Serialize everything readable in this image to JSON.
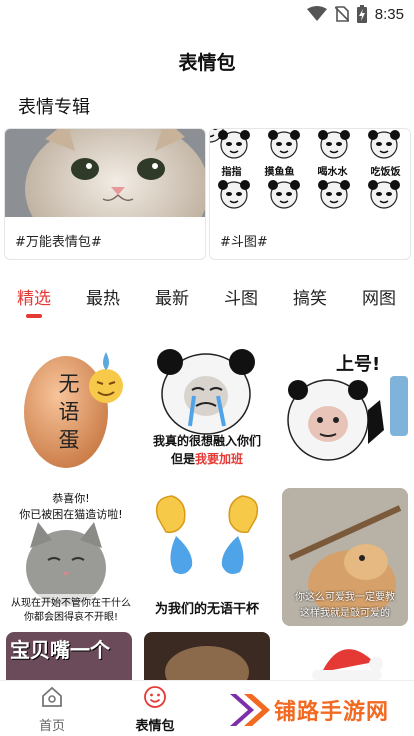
{
  "status_bar": {
    "time": "8:35",
    "icons": [
      "wifi-icon",
      "no-sim-icon",
      "battery-charging-icon"
    ]
  },
  "page_title": "表情包",
  "section": {
    "title": "表情专辑"
  },
  "albums": [
    {
      "label": "#万能表情包#",
      "cover": "cat-face-photo"
    },
    {
      "label": "#斗图#",
      "cover": "panda-meme-grid"
    }
  ],
  "panda_tags": [
    "指指",
    "摸鱼鱼",
    "喝水水",
    "吃饭饭"
  ],
  "tabs": [
    {
      "label": "精选",
      "active": true
    },
    {
      "label": "最热"
    },
    {
      "label": "最新"
    },
    {
      "label": "斗图"
    },
    {
      "label": "搞笑"
    },
    {
      "label": "网图"
    }
  ],
  "memes": {
    "egg": {
      "text": "无语蛋"
    },
    "panda1": {
      "line1": "我真的很想融入你们",
      "line2_prefix": "但是",
      "line2_red": "我要加班"
    },
    "panda2": {
      "text": "上号!"
    },
    "cat": {
      "top": "恭喜你!",
      "top2": "你已被困在猫造访啦!",
      "bottom": "从现在开始不管你在干什么",
      "bottom2": "你都会困得哀不开眼!"
    },
    "hands": {
      "text": "为我们的无语干杯"
    },
    "doge": {
      "line1": "你这么可爱我一定要教",
      "line2": "这样我就是敲可爱的"
    },
    "baby": {
      "text": "宝贝嘴一个"
    }
  },
  "bottom_nav": [
    {
      "label": "首页",
      "icon": "home-icon",
      "active": false
    },
    {
      "label": "表情包",
      "icon": "smile-icon",
      "active": true
    }
  ],
  "watermark": {
    "text": "铺路手游网"
  },
  "colors": {
    "accent": "#e53935",
    "watermark": "#f26a21"
  }
}
